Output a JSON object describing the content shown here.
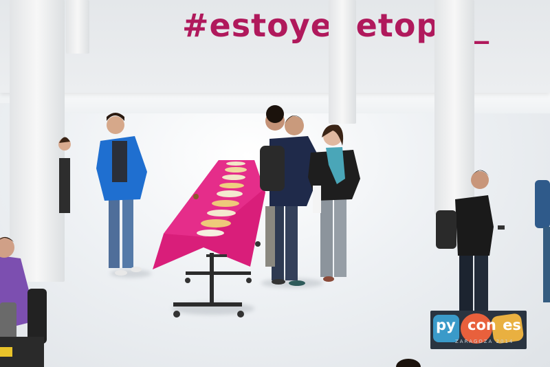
{
  "banner": {
    "hashtag": "#estoyenetopia_"
  },
  "logo": {
    "py": "py",
    "con": "con",
    "es": "es",
    "sub": "ZARAGOZA 2014"
  }
}
